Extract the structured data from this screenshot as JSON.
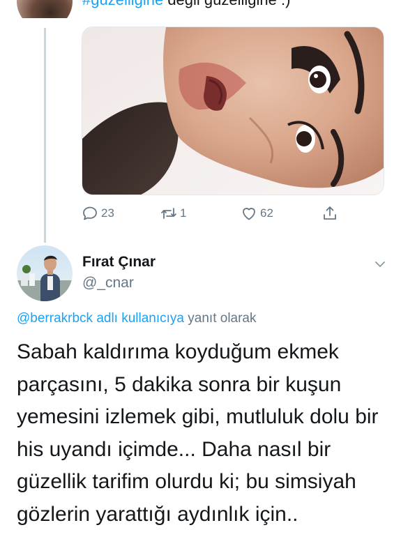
{
  "previous_tweet": {
    "text_hashtag": "#güzelliğine",
    "text_rest": " değil güzelliğine :)",
    "actions": {
      "reply_count": "23",
      "retweet_count": "1",
      "like_count": "62"
    }
  },
  "tweet": {
    "author_name": "Fırat Çınar",
    "author_handle": "@_cnar",
    "reply_mention": "@berrakrbck adlı kullanıcıya",
    "reply_suffix": " yanıt olarak",
    "text": "Sabah kaldırıma koyduğum ekmek parçasını, 5 dakika sonra bir kuşun yemesini izlemek gibi, mutluluk dolu bir his uyandı içimde... Daha nasıl bir güzellik tarifim olurdu ki; bu simsiyah gözlerin yarattığı aydınlık için.."
  },
  "icons": {
    "reply": "reply-icon",
    "retweet": "retweet-icon",
    "like": "heart-icon",
    "share": "share-icon",
    "more": "chevron-down-icon"
  },
  "colors": {
    "link": "#1da1f2",
    "secondary_text": "#657786",
    "primary_text": "#14171a",
    "thread_line": "#ccd6dd"
  }
}
